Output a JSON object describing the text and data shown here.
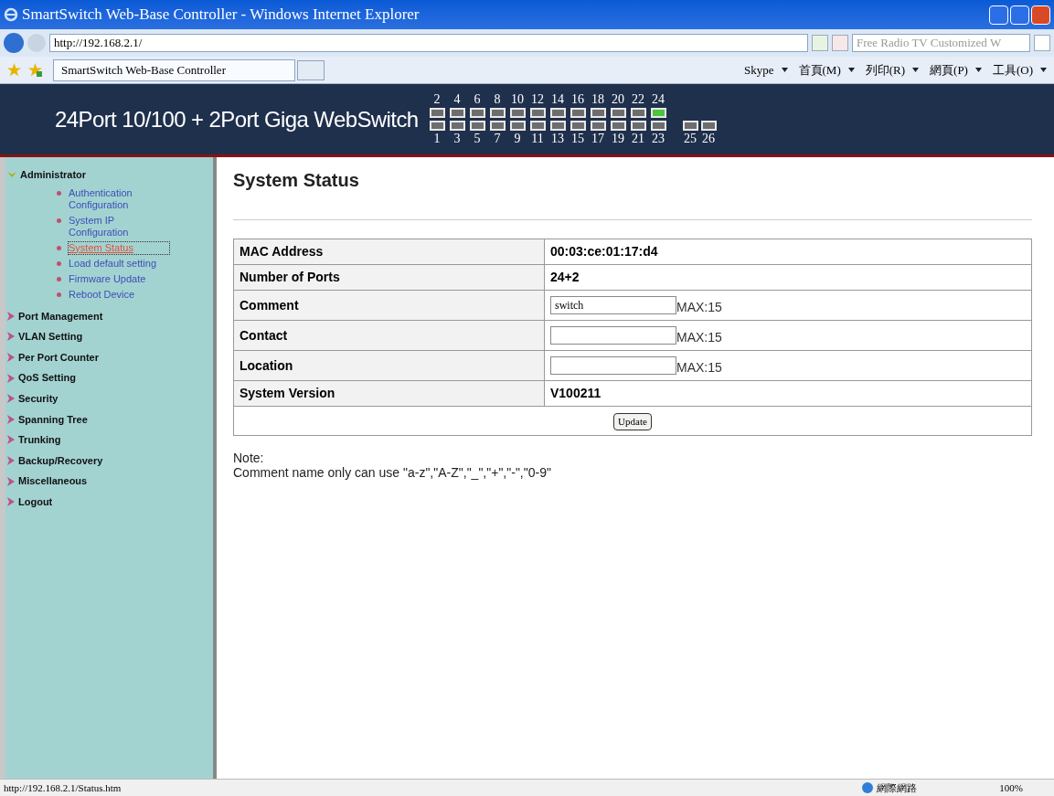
{
  "window": {
    "title": "SmartSwitch Web-Base Controller - Windows Internet Explorer"
  },
  "address_bar": {
    "url": "http://192.168.2.1/",
    "search_placeholder": "Free Radio TV Customized W"
  },
  "tabs": [
    {
      "label": "SmartSwitch Web-Base Controller",
      "selected": true
    }
  ],
  "command_bar": [
    {
      "label": "Skype"
    },
    {
      "label": "首頁(M)"
    },
    {
      "label": "列印(R)"
    },
    {
      "label": "網頁(P)"
    },
    {
      "label": "工具(O)"
    }
  ],
  "header": {
    "title": "24Port 10/100 + 2Port Giga WebSwitch",
    "top_ports": [
      {
        "label": "2",
        "linked": false
      },
      {
        "label": "4",
        "linked": false
      },
      {
        "label": "6",
        "linked": false
      },
      {
        "label": "8",
        "linked": false
      },
      {
        "label": "10",
        "linked": false
      },
      {
        "label": "12",
        "linked": false
      },
      {
        "label": "14",
        "linked": false
      },
      {
        "label": "16",
        "linked": false
      },
      {
        "label": "18",
        "linked": false
      },
      {
        "label": "20",
        "linked": false
      },
      {
        "label": "22",
        "linked": false
      },
      {
        "label": "24",
        "linked": true
      }
    ],
    "bottom_ports": [
      {
        "label": "1",
        "linked": false
      },
      {
        "label": "3",
        "linked": false
      },
      {
        "label": "5",
        "linked": false
      },
      {
        "label": "7",
        "linked": false
      },
      {
        "label": "9",
        "linked": false
      },
      {
        "label": "11",
        "linked": false
      },
      {
        "label": "13",
        "linked": false
      },
      {
        "label": "15",
        "linked": false
      },
      {
        "label": "17",
        "linked": false
      },
      {
        "label": "19",
        "linked": false
      },
      {
        "label": "21",
        "linked": false
      },
      {
        "label": "23",
        "linked": false
      }
    ],
    "giga_ports": [
      {
        "label": "25",
        "linked": false
      },
      {
        "label": "26",
        "linked": false
      }
    ]
  },
  "sidebar": {
    "items": [
      {
        "label": "Administrator",
        "expanded": true,
        "children": [
          {
            "label": "Authentication Configuration",
            "selected": false
          },
          {
            "label": "System IP Configuration",
            "selected": false
          },
          {
            "label": "System Status",
            "selected": true
          },
          {
            "label": "Load default setting",
            "selected": false
          },
          {
            "label": "Firmware Update",
            "selected": false
          },
          {
            "label": "Reboot Device",
            "selected": false
          }
        ]
      },
      {
        "label": "Port Management",
        "expanded": false
      },
      {
        "label": "VLAN Setting",
        "expanded": false
      },
      {
        "label": "Per Port Counter",
        "expanded": false
      },
      {
        "label": "QoS Setting",
        "expanded": false
      },
      {
        "label": "Security",
        "expanded": false
      },
      {
        "label": "Spanning Tree",
        "expanded": false
      },
      {
        "label": "Trunking",
        "expanded": false
      },
      {
        "label": "Backup/Recovery",
        "expanded": false
      },
      {
        "label": "Miscellaneous",
        "expanded": false
      },
      {
        "label": "Logout",
        "expanded": false
      }
    ]
  },
  "page": {
    "title": "System Status",
    "rows": [
      {
        "kind": "text",
        "label": "MAC Address",
        "value": "00:03:ce:01:17:d4"
      },
      {
        "kind": "text",
        "label": "Number of Ports",
        "value": "24+2"
      },
      {
        "kind": "input",
        "label": "Comment",
        "value": "switch",
        "hint": "MAX:15"
      },
      {
        "kind": "input",
        "label": "Contact",
        "hint": "MAX:15"
      },
      {
        "kind": "input",
        "label": "Location",
        "hint": "MAX:15"
      },
      {
        "kind": "text",
        "label": "System Version",
        "value": "V100211"
      }
    ],
    "button": "Update",
    "note_title": "Note:",
    "note": "Comment name only can use \"a-z\",\"A-Z\",\"_\",\"+\",\"-\",\"0-9\""
  },
  "status_bar": {
    "url": "http://192.168.2.1/Status.htm",
    "zone": "網際網路",
    "zoom": "100%"
  }
}
